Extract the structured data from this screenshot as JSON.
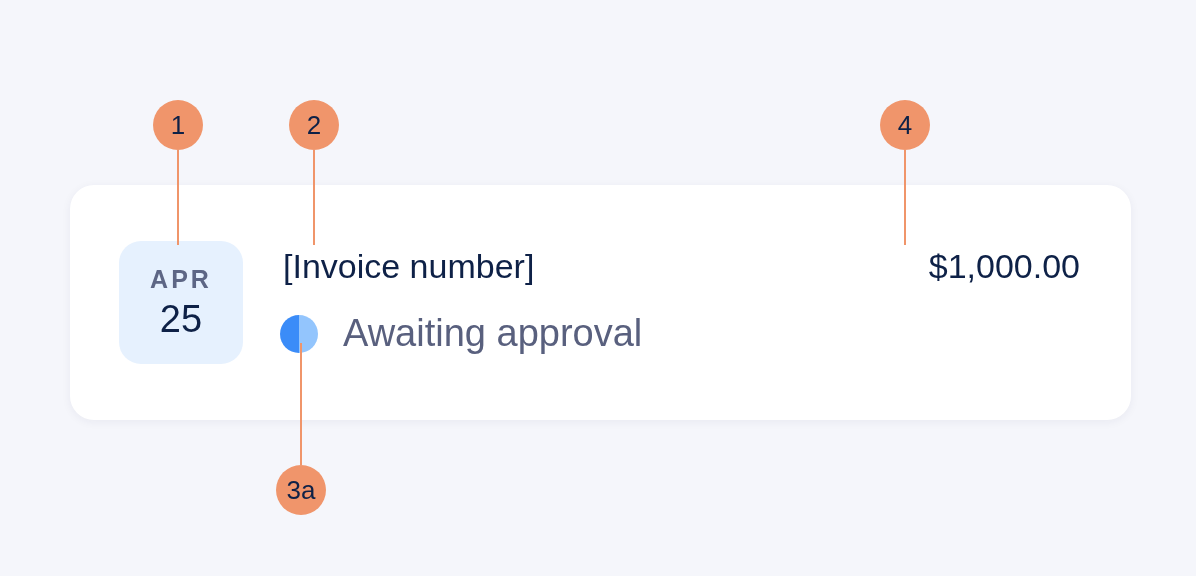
{
  "invoice": {
    "month": "APR",
    "day": "25",
    "title": "[Invoice number]",
    "amount": "$1,000.00",
    "status": "Awaiting approval"
  },
  "callouts": [
    {
      "label": "1"
    },
    {
      "label": "2"
    },
    {
      "label": "4"
    },
    {
      "label": "3a"
    }
  ]
}
